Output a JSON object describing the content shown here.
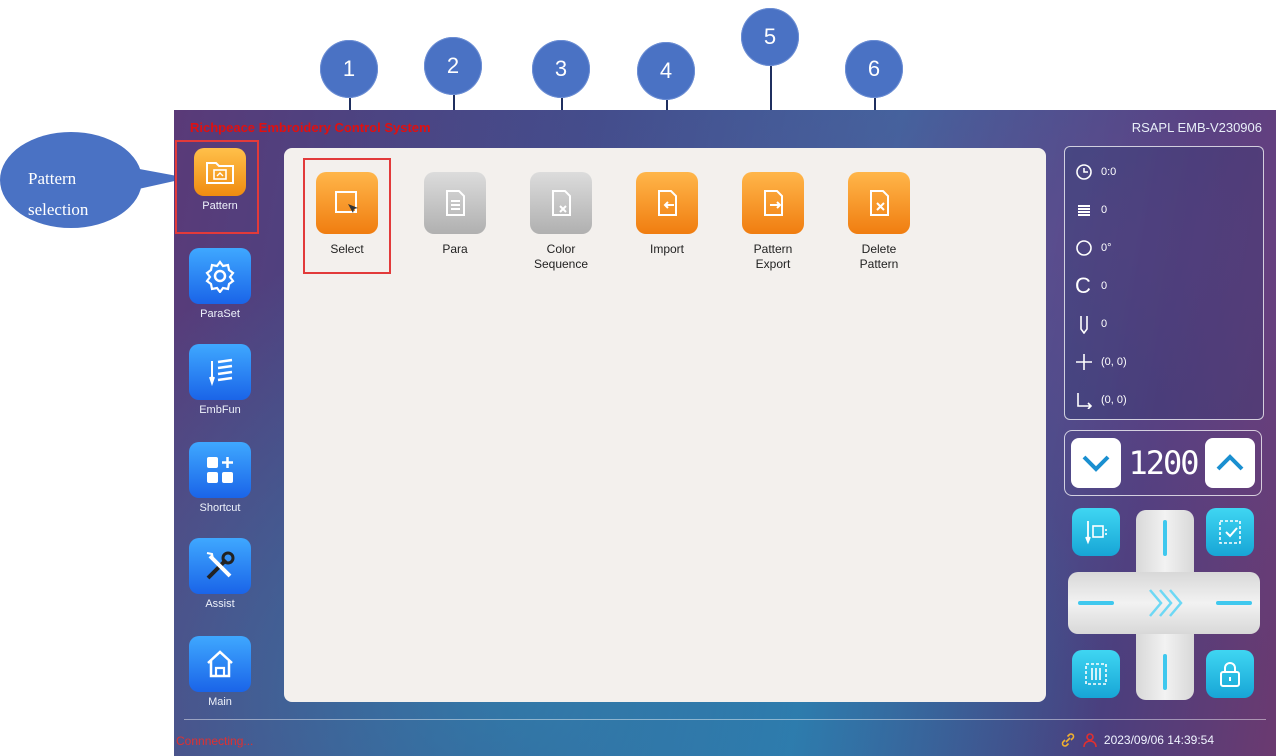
{
  "header": {
    "brand": "Richpeace Embroidery Control System",
    "version": "RSAPL EMB-V230906"
  },
  "callouts": [
    "1",
    "2",
    "3",
    "4",
    "5",
    "6"
  ],
  "pattern_callout": {
    "line1": "Pattern",
    "line2": "selection"
  },
  "nav": [
    {
      "label": "Pattern",
      "icon": "folder-icon",
      "active": true
    },
    {
      "label": "ParaSet",
      "icon": "gear-icon"
    },
    {
      "label": "EmbFun",
      "icon": "embroidery-icon"
    },
    {
      "label": "Shortcut",
      "icon": "shortcut-grid-icon"
    },
    {
      "label": "Assist",
      "icon": "tools-icon"
    },
    {
      "label": "Main",
      "icon": "home-icon"
    }
  ],
  "functions": [
    {
      "label": "Select",
      "style": "orange"
    },
    {
      "label": "Para",
      "style": "gray"
    },
    {
      "label": "Color Sequence",
      "line1": "Color",
      "line2": "Sequence",
      "style": "gray"
    },
    {
      "label": "Import",
      "style": "orange"
    },
    {
      "label": "Pattern Export",
      "line1": "Pattern",
      "line2": "Export",
      "style": "orange"
    },
    {
      "label": "Delete Pattern",
      "line1": "Delete",
      "line2": "Pattern",
      "style": "orange"
    }
  ],
  "info": {
    "time": "0:0",
    "stitches": "0",
    "angle": "0°",
    "color": "0",
    "needle": "0",
    "position": "(0, 0)",
    "origin": "(0, 0)"
  },
  "speed": {
    "value": "1200"
  },
  "status": {
    "connection": "Connnecting...",
    "datetime": "2023/09/06 14:39:54"
  },
  "colors": {
    "accent_orange": "#f08b10",
    "accent_blue": "#1a64e8",
    "brand_red": "#e01010",
    "callout_blue": "#4a72c4"
  }
}
